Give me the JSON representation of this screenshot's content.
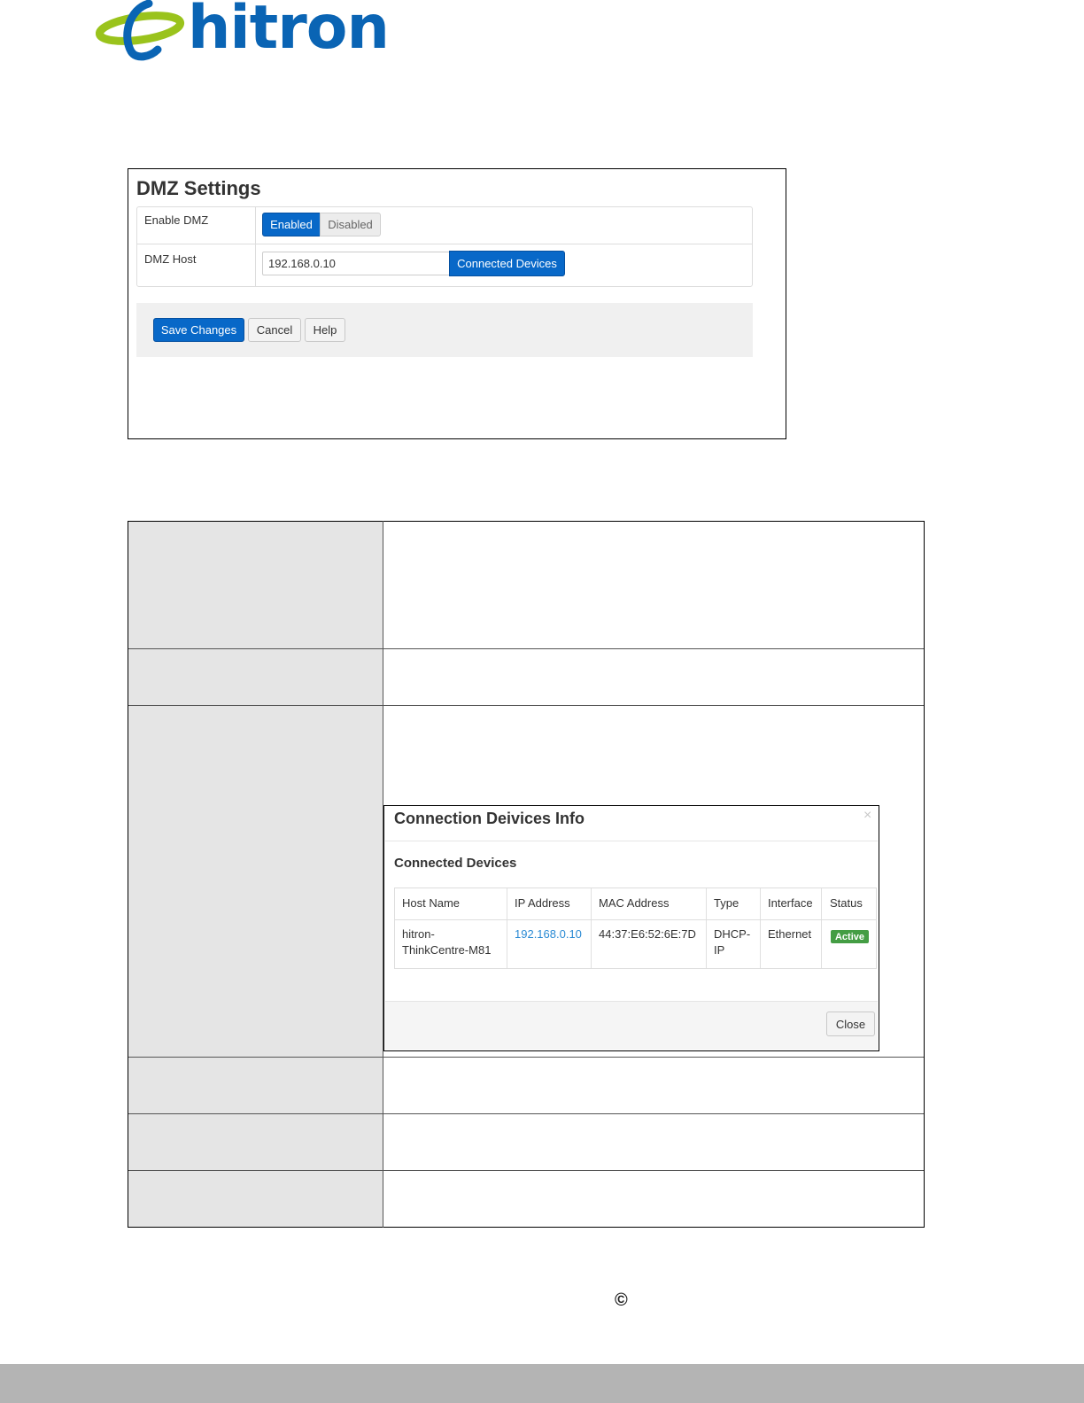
{
  "brand": {
    "logo_text": "hitron",
    "brand_color": "#0a64b4",
    "swoosh_color": "#9ac31c"
  },
  "dmz": {
    "title": "DMZ Settings",
    "enable_label": "Enable DMZ",
    "enabled_btn": "Enabled",
    "disabled_btn": "Disabled",
    "enabled_selected": true,
    "host_label": "DMZ Host",
    "host_value": "192.168.0.10",
    "connected_devices_btn": "Connected Devices",
    "save_btn": "Save Changes",
    "cancel_btn": "Cancel",
    "help_btn": "Help"
  },
  "modal": {
    "title": "Connection Deivices Info",
    "close_x": "×",
    "subtitle": "Connected Devices",
    "headers": [
      "Host Name",
      "IP Address",
      "MAC Address",
      "Type",
      "Interface",
      "Status"
    ],
    "row": {
      "host_line1": "hitron-",
      "host_line2": "ThinkCentre-M81",
      "ip": "192.168.0.10",
      "mac": "44:37:E6:52:6E:7D",
      "type_line1": "DHCP-",
      "type_line2": "IP",
      "interface": "Ethernet",
      "status": "Active"
    },
    "close_btn": "Close",
    "status_color": "#449d44",
    "link_color": "#2a8ad4"
  },
  "footer": {
    "copyright_symbol": "©"
  }
}
